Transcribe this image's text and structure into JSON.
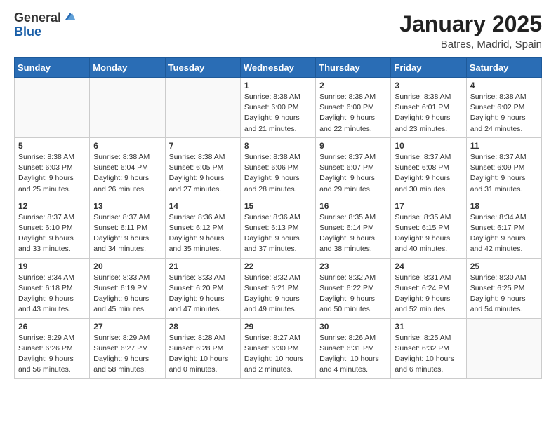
{
  "header": {
    "logo_general": "General",
    "logo_blue": "Blue",
    "month": "January 2025",
    "location": "Batres, Madrid, Spain"
  },
  "days_of_week": [
    "Sunday",
    "Monday",
    "Tuesday",
    "Wednesday",
    "Thursday",
    "Friday",
    "Saturday"
  ],
  "weeks": [
    [
      {
        "day": "",
        "info": ""
      },
      {
        "day": "",
        "info": ""
      },
      {
        "day": "",
        "info": ""
      },
      {
        "day": "1",
        "info": "Sunrise: 8:38 AM\nSunset: 6:00 PM\nDaylight: 9 hours\nand 21 minutes."
      },
      {
        "day": "2",
        "info": "Sunrise: 8:38 AM\nSunset: 6:00 PM\nDaylight: 9 hours\nand 22 minutes."
      },
      {
        "day": "3",
        "info": "Sunrise: 8:38 AM\nSunset: 6:01 PM\nDaylight: 9 hours\nand 23 minutes."
      },
      {
        "day": "4",
        "info": "Sunrise: 8:38 AM\nSunset: 6:02 PM\nDaylight: 9 hours\nand 24 minutes."
      }
    ],
    [
      {
        "day": "5",
        "info": "Sunrise: 8:38 AM\nSunset: 6:03 PM\nDaylight: 9 hours\nand 25 minutes."
      },
      {
        "day": "6",
        "info": "Sunrise: 8:38 AM\nSunset: 6:04 PM\nDaylight: 9 hours\nand 26 minutes."
      },
      {
        "day": "7",
        "info": "Sunrise: 8:38 AM\nSunset: 6:05 PM\nDaylight: 9 hours\nand 27 minutes."
      },
      {
        "day": "8",
        "info": "Sunrise: 8:38 AM\nSunset: 6:06 PM\nDaylight: 9 hours\nand 28 minutes."
      },
      {
        "day": "9",
        "info": "Sunrise: 8:37 AM\nSunset: 6:07 PM\nDaylight: 9 hours\nand 29 minutes."
      },
      {
        "day": "10",
        "info": "Sunrise: 8:37 AM\nSunset: 6:08 PM\nDaylight: 9 hours\nand 30 minutes."
      },
      {
        "day": "11",
        "info": "Sunrise: 8:37 AM\nSunset: 6:09 PM\nDaylight: 9 hours\nand 31 minutes."
      }
    ],
    [
      {
        "day": "12",
        "info": "Sunrise: 8:37 AM\nSunset: 6:10 PM\nDaylight: 9 hours\nand 33 minutes."
      },
      {
        "day": "13",
        "info": "Sunrise: 8:37 AM\nSunset: 6:11 PM\nDaylight: 9 hours\nand 34 minutes."
      },
      {
        "day": "14",
        "info": "Sunrise: 8:36 AM\nSunset: 6:12 PM\nDaylight: 9 hours\nand 35 minutes."
      },
      {
        "day": "15",
        "info": "Sunrise: 8:36 AM\nSunset: 6:13 PM\nDaylight: 9 hours\nand 37 minutes."
      },
      {
        "day": "16",
        "info": "Sunrise: 8:35 AM\nSunset: 6:14 PM\nDaylight: 9 hours\nand 38 minutes."
      },
      {
        "day": "17",
        "info": "Sunrise: 8:35 AM\nSunset: 6:15 PM\nDaylight: 9 hours\nand 40 minutes."
      },
      {
        "day": "18",
        "info": "Sunrise: 8:34 AM\nSunset: 6:17 PM\nDaylight: 9 hours\nand 42 minutes."
      }
    ],
    [
      {
        "day": "19",
        "info": "Sunrise: 8:34 AM\nSunset: 6:18 PM\nDaylight: 9 hours\nand 43 minutes."
      },
      {
        "day": "20",
        "info": "Sunrise: 8:33 AM\nSunset: 6:19 PM\nDaylight: 9 hours\nand 45 minutes."
      },
      {
        "day": "21",
        "info": "Sunrise: 8:33 AM\nSunset: 6:20 PM\nDaylight: 9 hours\nand 47 minutes."
      },
      {
        "day": "22",
        "info": "Sunrise: 8:32 AM\nSunset: 6:21 PM\nDaylight: 9 hours\nand 49 minutes."
      },
      {
        "day": "23",
        "info": "Sunrise: 8:32 AM\nSunset: 6:22 PM\nDaylight: 9 hours\nand 50 minutes."
      },
      {
        "day": "24",
        "info": "Sunrise: 8:31 AM\nSunset: 6:24 PM\nDaylight: 9 hours\nand 52 minutes."
      },
      {
        "day": "25",
        "info": "Sunrise: 8:30 AM\nSunset: 6:25 PM\nDaylight: 9 hours\nand 54 minutes."
      }
    ],
    [
      {
        "day": "26",
        "info": "Sunrise: 8:29 AM\nSunset: 6:26 PM\nDaylight: 9 hours\nand 56 minutes."
      },
      {
        "day": "27",
        "info": "Sunrise: 8:29 AM\nSunset: 6:27 PM\nDaylight: 9 hours\nand 58 minutes."
      },
      {
        "day": "28",
        "info": "Sunrise: 8:28 AM\nSunset: 6:28 PM\nDaylight: 10 hours\nand 0 minutes."
      },
      {
        "day": "29",
        "info": "Sunrise: 8:27 AM\nSunset: 6:30 PM\nDaylight: 10 hours\nand 2 minutes."
      },
      {
        "day": "30",
        "info": "Sunrise: 8:26 AM\nSunset: 6:31 PM\nDaylight: 10 hours\nand 4 minutes."
      },
      {
        "day": "31",
        "info": "Sunrise: 8:25 AM\nSunset: 6:32 PM\nDaylight: 10 hours\nand 6 minutes."
      },
      {
        "day": "",
        "info": ""
      }
    ]
  ]
}
